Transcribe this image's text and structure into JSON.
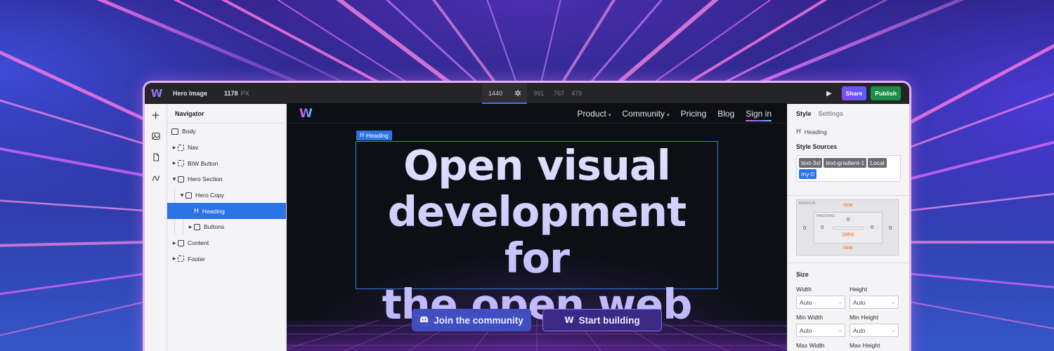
{
  "app": {
    "element_label": "Hero Image",
    "width_value": "1178",
    "width_unit": "PX",
    "breakpoints": [
      "1440",
      "991",
      "767",
      "479"
    ],
    "share_label": "Share",
    "publish_label": "Publish"
  },
  "navigator": {
    "title": "Navigator",
    "items": [
      {
        "label": "Body"
      },
      {
        "label": "Nav"
      },
      {
        "label": "BIW Button"
      },
      {
        "label": "Hero Section"
      },
      {
        "label": "Hero Copy"
      },
      {
        "label": "Heading"
      },
      {
        "label": "Buttons"
      },
      {
        "label": "Content"
      },
      {
        "label": "Footer"
      }
    ]
  },
  "site": {
    "nav": [
      {
        "label": "Product"
      },
      {
        "label": "Community"
      },
      {
        "label": "Pricing"
      },
      {
        "label": "Blog"
      },
      {
        "label": "Sign in"
      }
    ],
    "selection_label": "Heading",
    "heading_lines": [
      "Open visual",
      "development for",
      "the open web"
    ],
    "cta_join": "Join the community",
    "cta_start": "Start building"
  },
  "style_panel": {
    "tabs": [
      "Style",
      "Settings"
    ],
    "element": "Heading",
    "sources_title": "Style Sources",
    "sources": [
      "text-3xl",
      "text-gradient-1",
      "Local",
      "my-0"
    ],
    "box": {
      "margin_label": "MARGIN",
      "padding_label": "PADDING",
      "margin_top": "0EM",
      "margin_left": "0",
      "margin_right": "0",
      "margin_bottom": "0EM",
      "padding_top": "0",
      "padding_left": "0",
      "padding_right": "0",
      "padding_bottom": "20PX"
    },
    "size_title": "Size",
    "size": {
      "width_label": "Width",
      "width_value": "Auto",
      "height_label": "Height",
      "height_value": "Auto",
      "min_width_label": "Min Width",
      "min_width_value": "Auto",
      "min_height_label": "Min Height",
      "min_height_value": "Auto",
      "max_width_label": "Max Width",
      "max_height_label": "Max Height"
    }
  },
  "colors": {
    "accent_blue": "#2d73e8",
    "publish_green": "#1a8f4a",
    "window_glow": "#e3b3f2"
  }
}
